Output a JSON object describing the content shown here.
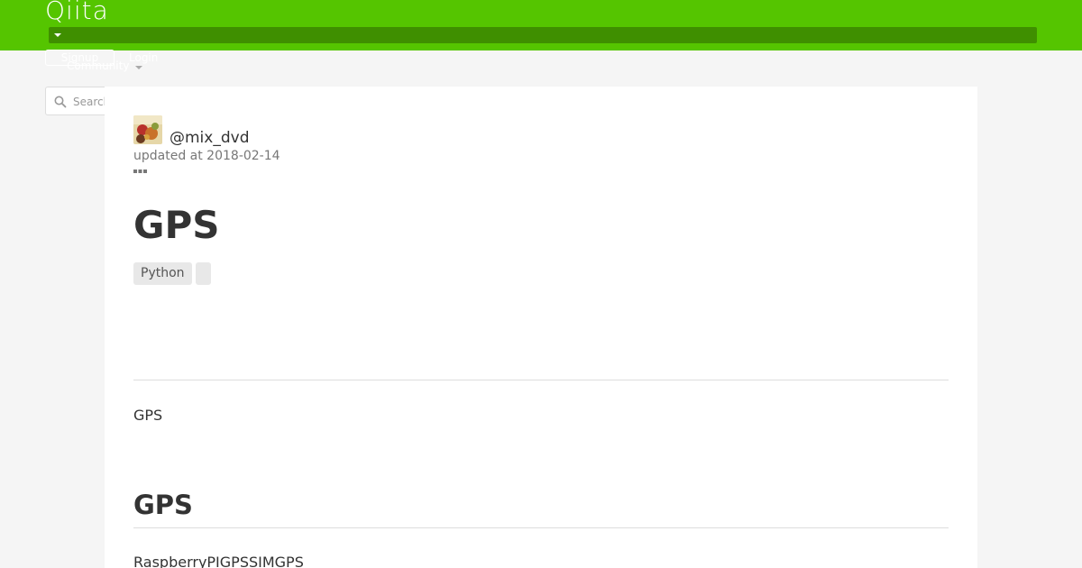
{
  "header": {
    "logo": "Qiita",
    "signup_label": "Signup",
    "login_label": "Login",
    "community_label": "Community",
    "brand_color": "#55c500",
    "menu_strip_color": "#3f8f00"
  },
  "search": {
    "placeholder": "Search",
    "value": ""
  },
  "article": {
    "author": "@mix_dvd",
    "updated": "updated at 2018-02-14",
    "title": "GPS",
    "tags": [
      "Python",
      ""
    ],
    "intro": "GPS",
    "section_heading": "GPS",
    "section_text": "RaspberryPIGPSSIMGPS"
  },
  "icons": {
    "search": "search-icon",
    "more": "more-icon",
    "menu_caret": "caret-down-icon",
    "community_caret": "caret-down-icon"
  }
}
